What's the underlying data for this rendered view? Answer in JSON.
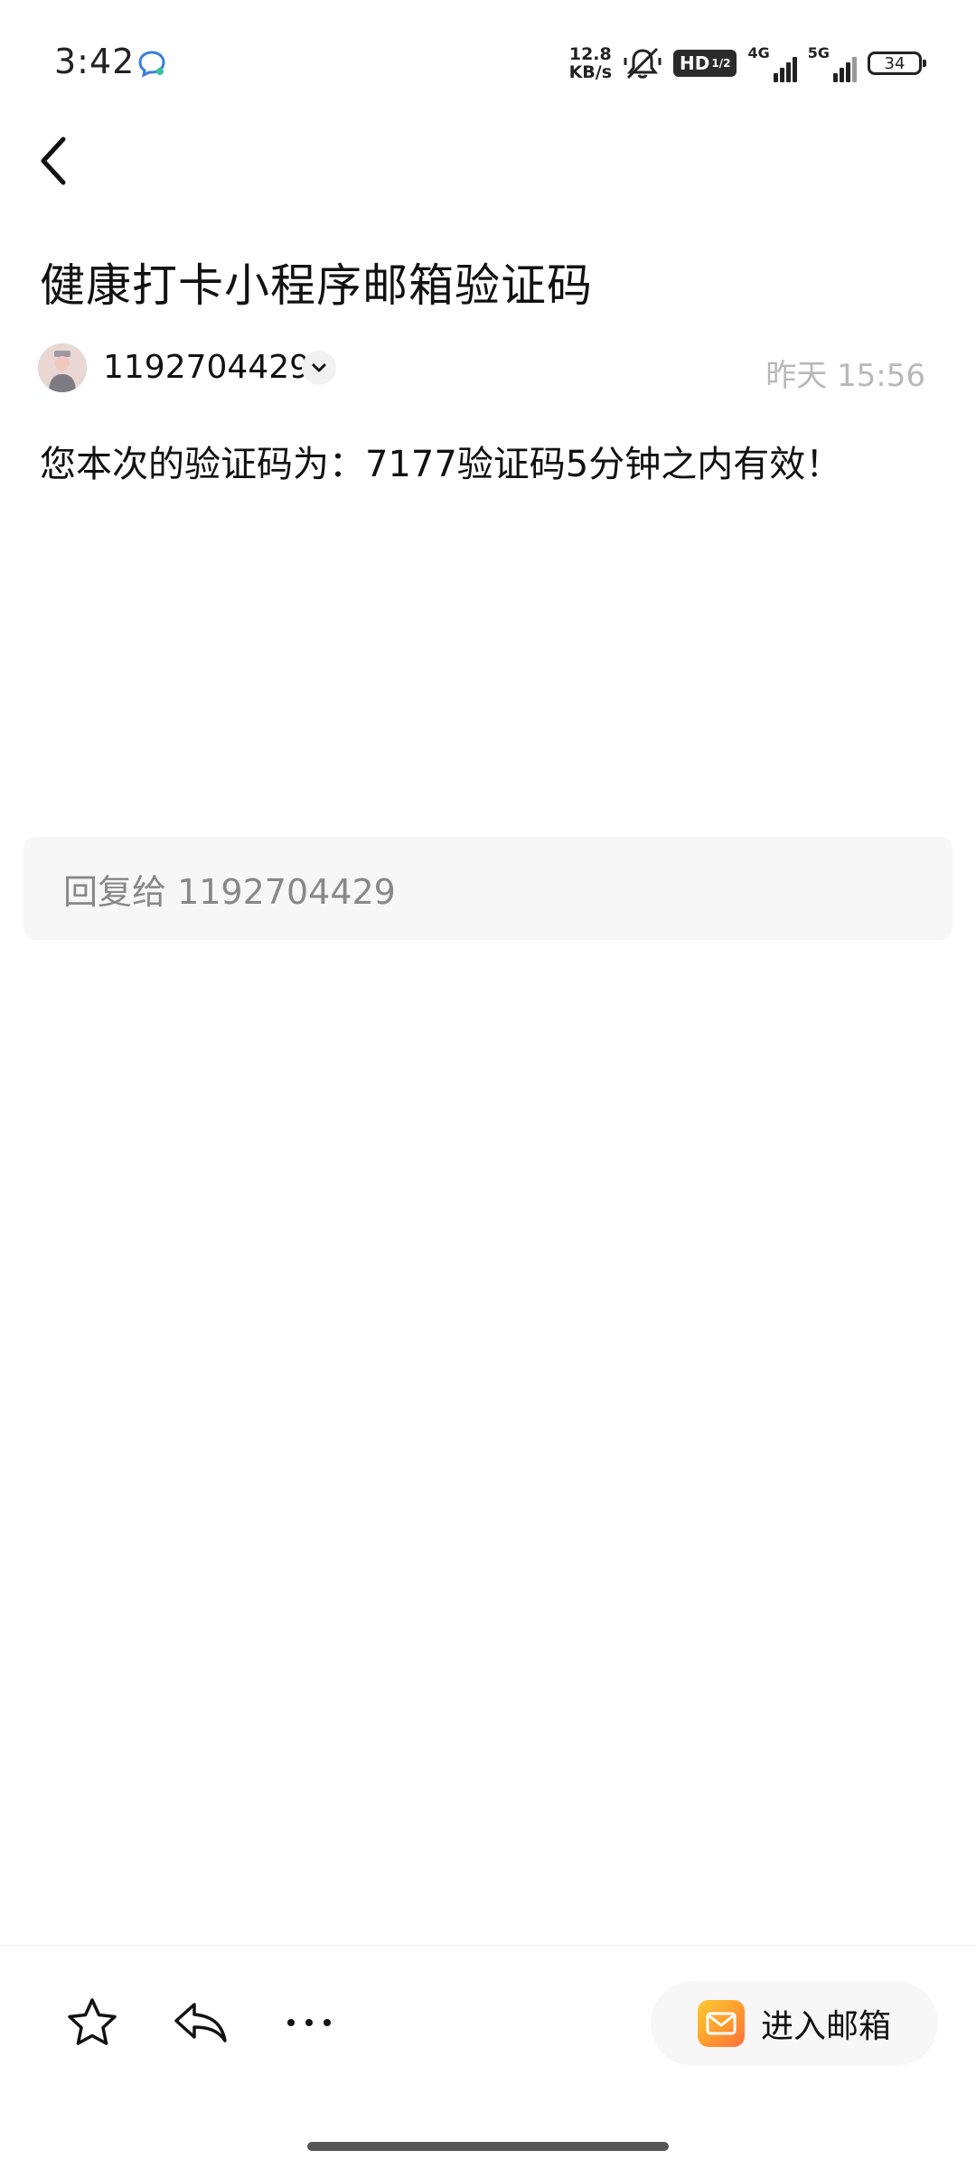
{
  "status_bar": {
    "time": "3:42",
    "net_speed_value": "12.8",
    "net_speed_unit": "KB/s",
    "hd_label": "HD",
    "hd_sub": "1/2",
    "sim1_label": "4G",
    "sim2_label": "5G",
    "battery": "34"
  },
  "email": {
    "subject": "健康打卡小程序邮箱验证码",
    "sender": "1192704429",
    "time": "昨天 15:56",
    "body": "您本次的验证码为：7177验证码5分钟之内有效！"
  },
  "reply": {
    "placeholder": "回复给 1192704429"
  },
  "toolbar": {
    "enter_mailbox_label": "进入邮箱"
  },
  "icons": {
    "back": "chevron-left-icon",
    "star": "star-icon",
    "reply": "reply-icon",
    "more": "more-icon",
    "mail": "mail-icon"
  },
  "colors": {
    "time_gray": "#b8b8b8",
    "placeholder_gray": "#888888",
    "mail_icon_orange": "#ff9a2e"
  }
}
